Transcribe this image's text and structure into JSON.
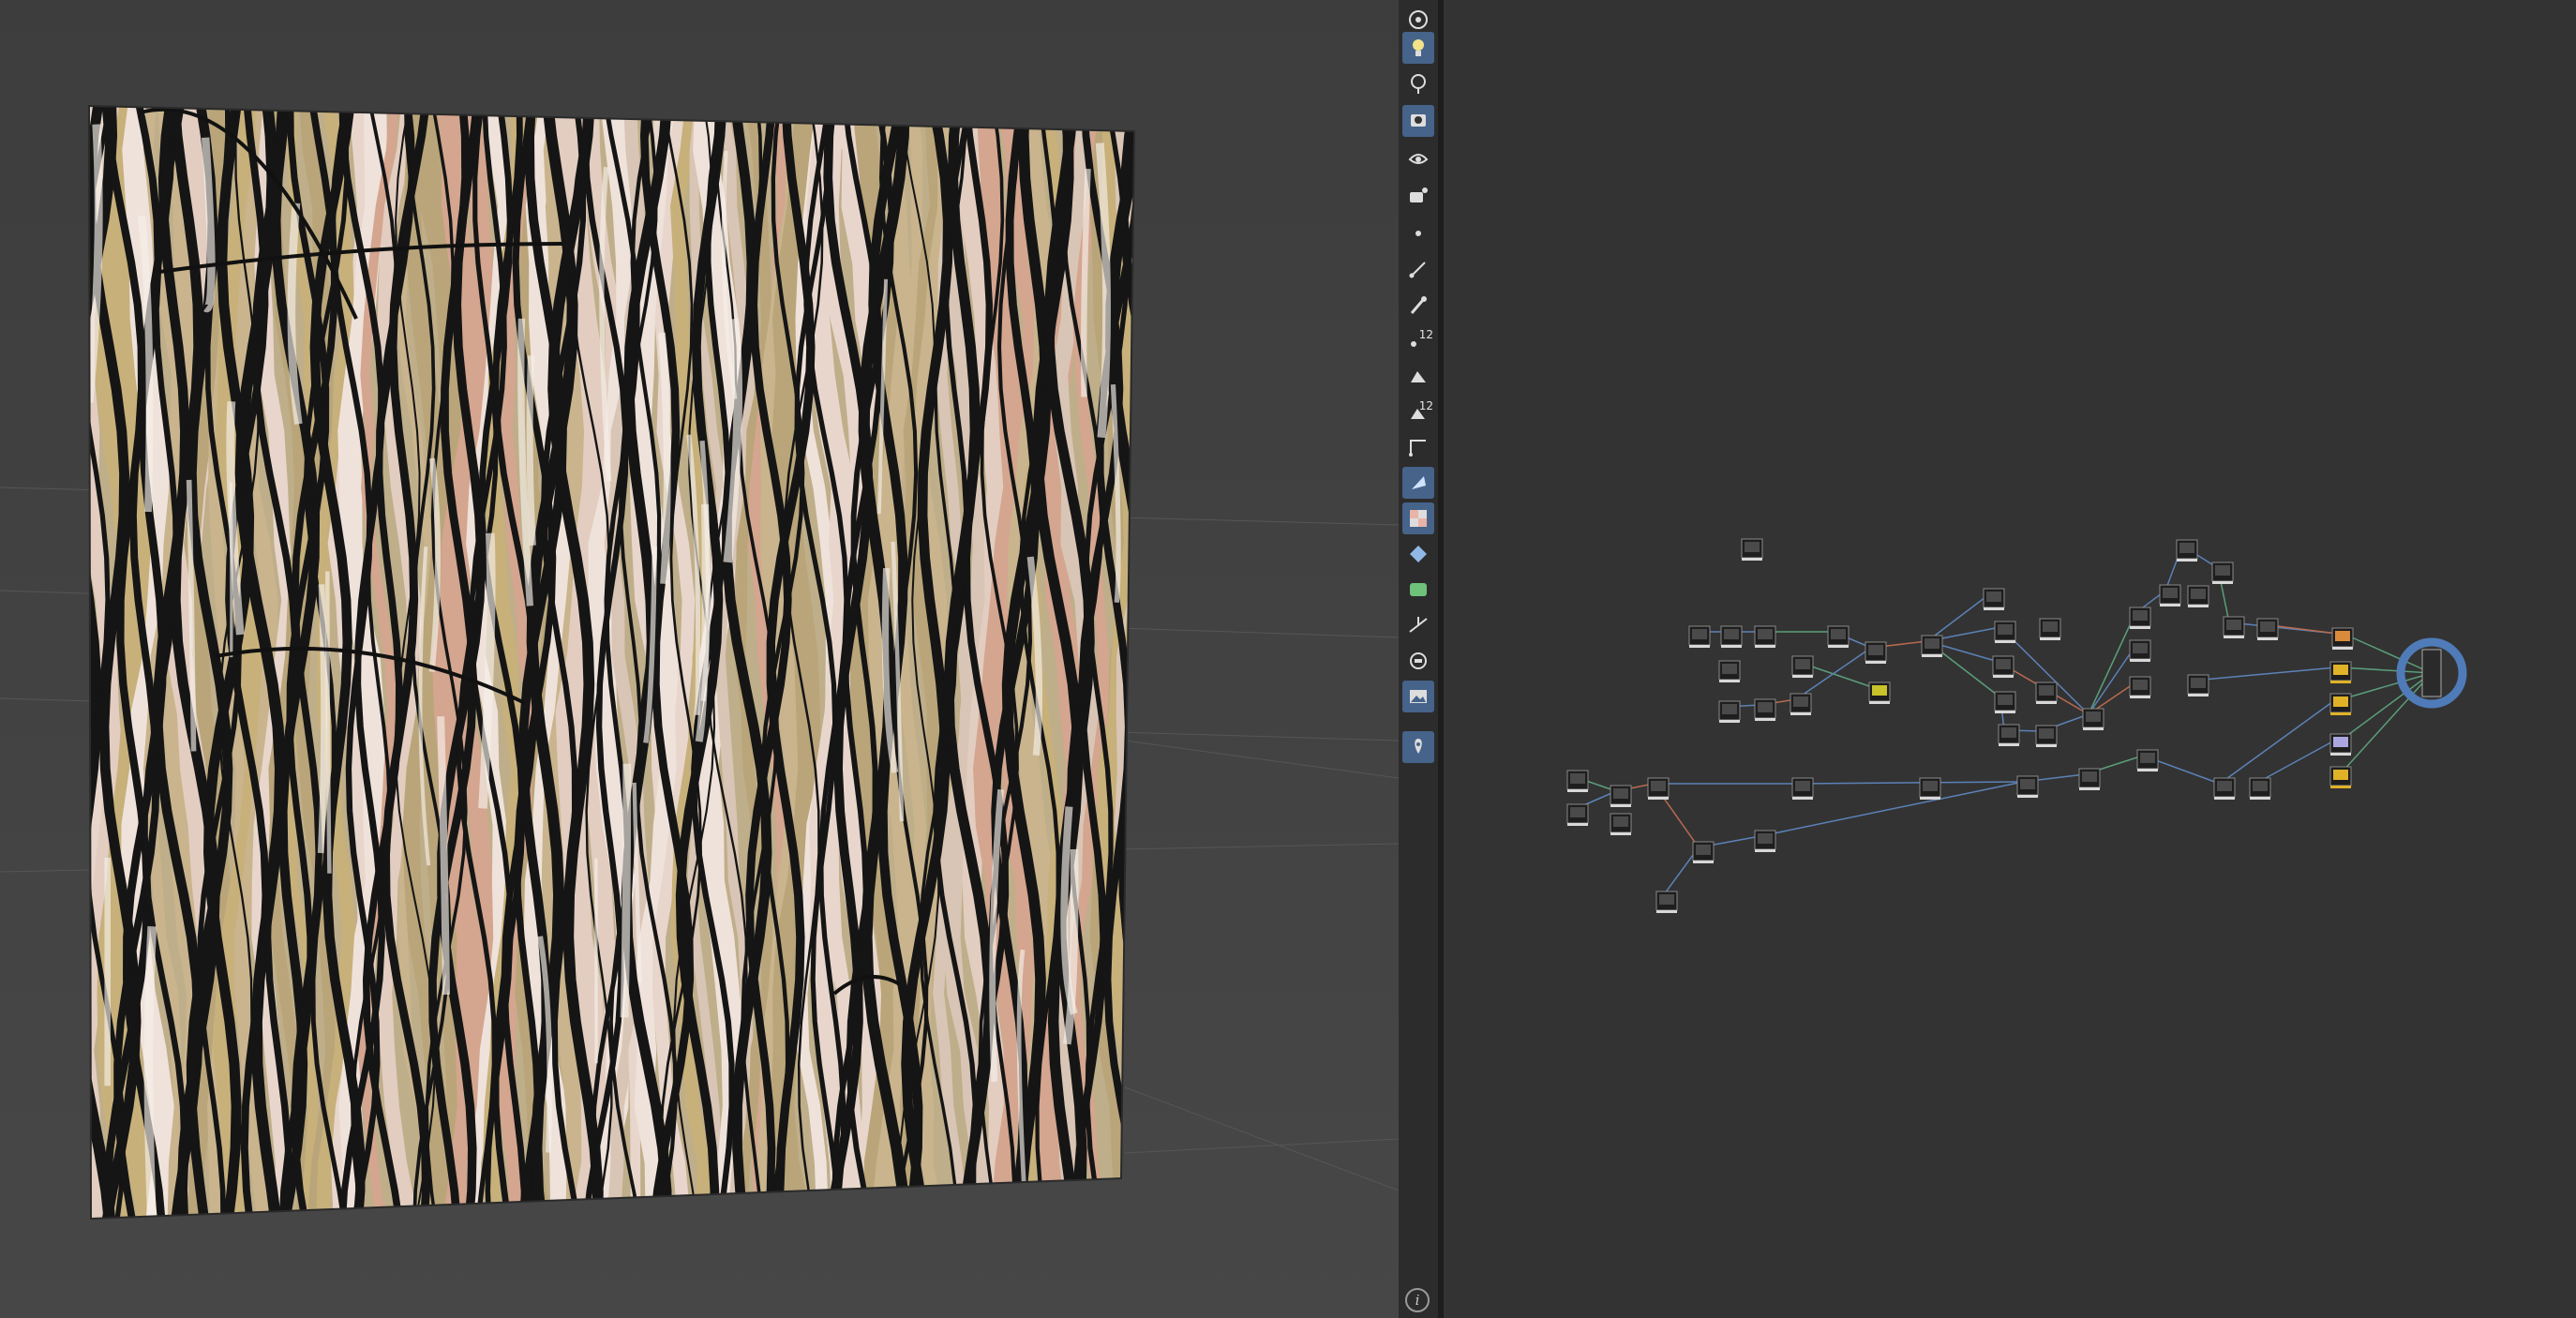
{
  "toolbar": {
    "tools": [
      {
        "name": "camera-orbit-icon",
        "label": ""
      },
      {
        "name": "light-icon",
        "label": ""
      },
      {
        "name": "environment-icon",
        "label": ""
      },
      {
        "name": "render-view-icon",
        "label": ""
      },
      {
        "name": "camera-settings-icon",
        "label": ""
      },
      {
        "name": "capture-icon",
        "label": ""
      },
      {
        "name": "point-icon",
        "label": ""
      },
      {
        "name": "paint-stroke-icon",
        "label": ""
      },
      {
        "name": "brush-icon",
        "label": ""
      },
      {
        "name": "numbered-points-icon",
        "label": "12"
      },
      {
        "name": "fill-icon",
        "label": ""
      },
      {
        "name": "numbered-fill-icon",
        "label": "12"
      },
      {
        "name": "polygon-icon",
        "label": ""
      },
      {
        "name": "bake-icon",
        "label": ""
      },
      {
        "name": "checker-icon",
        "label": ""
      },
      {
        "name": "material-icon",
        "label": ""
      },
      {
        "name": "uv-icon",
        "label": ""
      },
      {
        "name": "axis-icon",
        "label": ""
      },
      {
        "name": "display-icon",
        "label": ""
      },
      {
        "name": "image-icon",
        "label": ""
      },
      {
        "name": "pin-icon",
        "label": ""
      }
    ],
    "info_label": "i"
  },
  "accent_color": "#46638a",
  "output_node_color": "#4f7bb8"
}
